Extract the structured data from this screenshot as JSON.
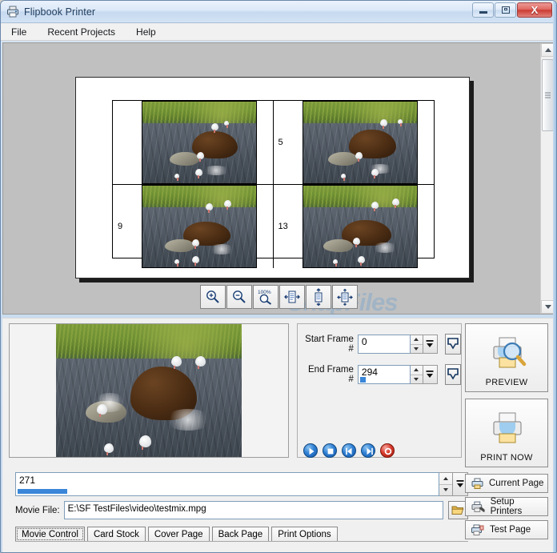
{
  "window": {
    "title": "Flipbook Printer",
    "icon": "printer-icon",
    "minimize_label": "Minimize",
    "maximize_label": "Maximize",
    "close_label": "X"
  },
  "menu": {
    "items": [
      {
        "label": "File",
        "name": "menu-file"
      },
      {
        "label": "Recent Projects",
        "name": "menu-recent-projects"
      },
      {
        "label": "Help",
        "name": "menu-help"
      }
    ]
  },
  "preview": {
    "watermark": "SnapFiles",
    "cells": [
      {
        "number": "",
        "name": "preview-cell-1"
      },
      {
        "number": "5",
        "name": "preview-cell-2"
      },
      {
        "number": "9",
        "name": "preview-cell-3"
      },
      {
        "number": "13",
        "name": "preview-cell-4"
      }
    ],
    "toolbar": [
      {
        "name": "zoom-in-button",
        "label": "Zoom In",
        "icon": "magnifier-plus-icon"
      },
      {
        "name": "zoom-out-button",
        "label": "Zoom Out",
        "icon": "magnifier-minus-icon"
      },
      {
        "name": "zoom-100-button",
        "label": "100%",
        "icon": "magnifier-100-icon"
      },
      {
        "name": "fit-width-button",
        "label": "Fit Width",
        "icon": "page-fit-width-icon"
      },
      {
        "name": "fit-height-button",
        "label": "Fit Height",
        "icon": "page-fit-height-icon"
      },
      {
        "name": "fit-page-button",
        "label": "Fit Page",
        "icon": "page-fit-all-icon"
      }
    ]
  },
  "movie_control": {
    "start_frame": {
      "label": "Start Frame #",
      "value": "0"
    },
    "end_frame": {
      "label": "End Frame #",
      "value": "294"
    },
    "grab_start_label": "Grab Start Frame",
    "grab_end_label": "Grab End Frame",
    "transport": [
      {
        "name": "play-button",
        "label": "Play",
        "color": "#2f7fd4"
      },
      {
        "name": "stop-button",
        "label": "Stop",
        "color": "#2f7fd4"
      },
      {
        "name": "previous-frame-button",
        "label": "Previous",
        "color": "#2f7fd4"
      },
      {
        "name": "next-frame-button",
        "label": "Next",
        "color": "#2f7fd4"
      },
      {
        "name": "record-button",
        "label": "Record",
        "color": "#d83b2c"
      }
    ],
    "current_frame": "271",
    "movie_file_label": "Movie File:",
    "movie_file_path": "E:\\SF TestFiles\\video\\testmix.mpg",
    "browse_label": "Browse"
  },
  "tabs": [
    {
      "label": "Movie Control",
      "name": "tab-movie-control",
      "active": true
    },
    {
      "label": "Card Stock",
      "name": "tab-card-stock",
      "active": false
    },
    {
      "label": "Cover Page",
      "name": "tab-cover-page",
      "active": false
    },
    {
      "label": "Back Page",
      "name": "tab-back-page",
      "active": false
    },
    {
      "label": "Print Options",
      "name": "tab-print-options",
      "active": false
    }
  ],
  "actions": {
    "preview": {
      "label": "PREVIEW",
      "icon": "printer-magnifier-icon"
    },
    "print_now": {
      "label": "PRINT NOW",
      "icon": "printer-icon"
    },
    "current_page": {
      "label": "Current Page",
      "icon": "printer-small-icon"
    },
    "setup_printers": {
      "label": "Setup Printers",
      "icon": "printer-setup-icon"
    },
    "test_page": {
      "label": "Test Page",
      "icon": "printer-test-icon"
    }
  },
  "colors": {
    "accent": "#3a86d8",
    "titlebar": "#dbe8f7",
    "close_button": "#cc3b33",
    "record": "#d83b2c"
  }
}
